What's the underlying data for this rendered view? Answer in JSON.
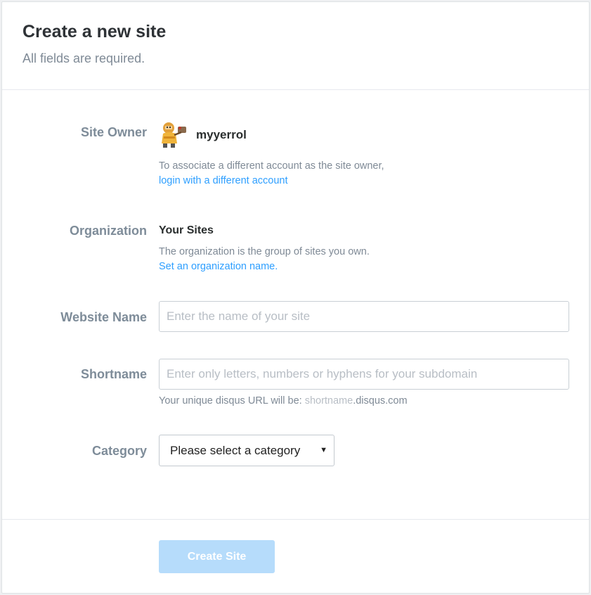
{
  "header": {
    "title": "Create a new site",
    "subtitle": "All fields are required."
  },
  "site_owner": {
    "label": "Site Owner",
    "avatar_icon": "mascot-avatar-icon",
    "username": "myyerrol",
    "help_text": "To associate a different account as the site owner,",
    "link_text": "login with a different account"
  },
  "organization": {
    "label": "Organization",
    "name": "Your Sites",
    "help_text": "The organization is the group of sites you own.",
    "link_text": "Set an organization name."
  },
  "website_name": {
    "label": "Website Name",
    "value": "",
    "placeholder": "Enter the name of your site"
  },
  "shortname": {
    "label": "Shortname",
    "value": "",
    "placeholder": "Enter only letters, numbers or hyphens for your subdomain",
    "url_prefix": "Your unique disqus URL will be: ",
    "url_sub": "shortname",
    "url_suffix": ".disqus.com"
  },
  "category": {
    "label": "Category",
    "selected": "Please select a category",
    "caret_icon": "caret-down-icon"
  },
  "submit": {
    "label": "Create Site",
    "color": "#b6dcfb"
  },
  "colors": {
    "link": "#2e9fff",
    "label": "#7e8c99"
  }
}
